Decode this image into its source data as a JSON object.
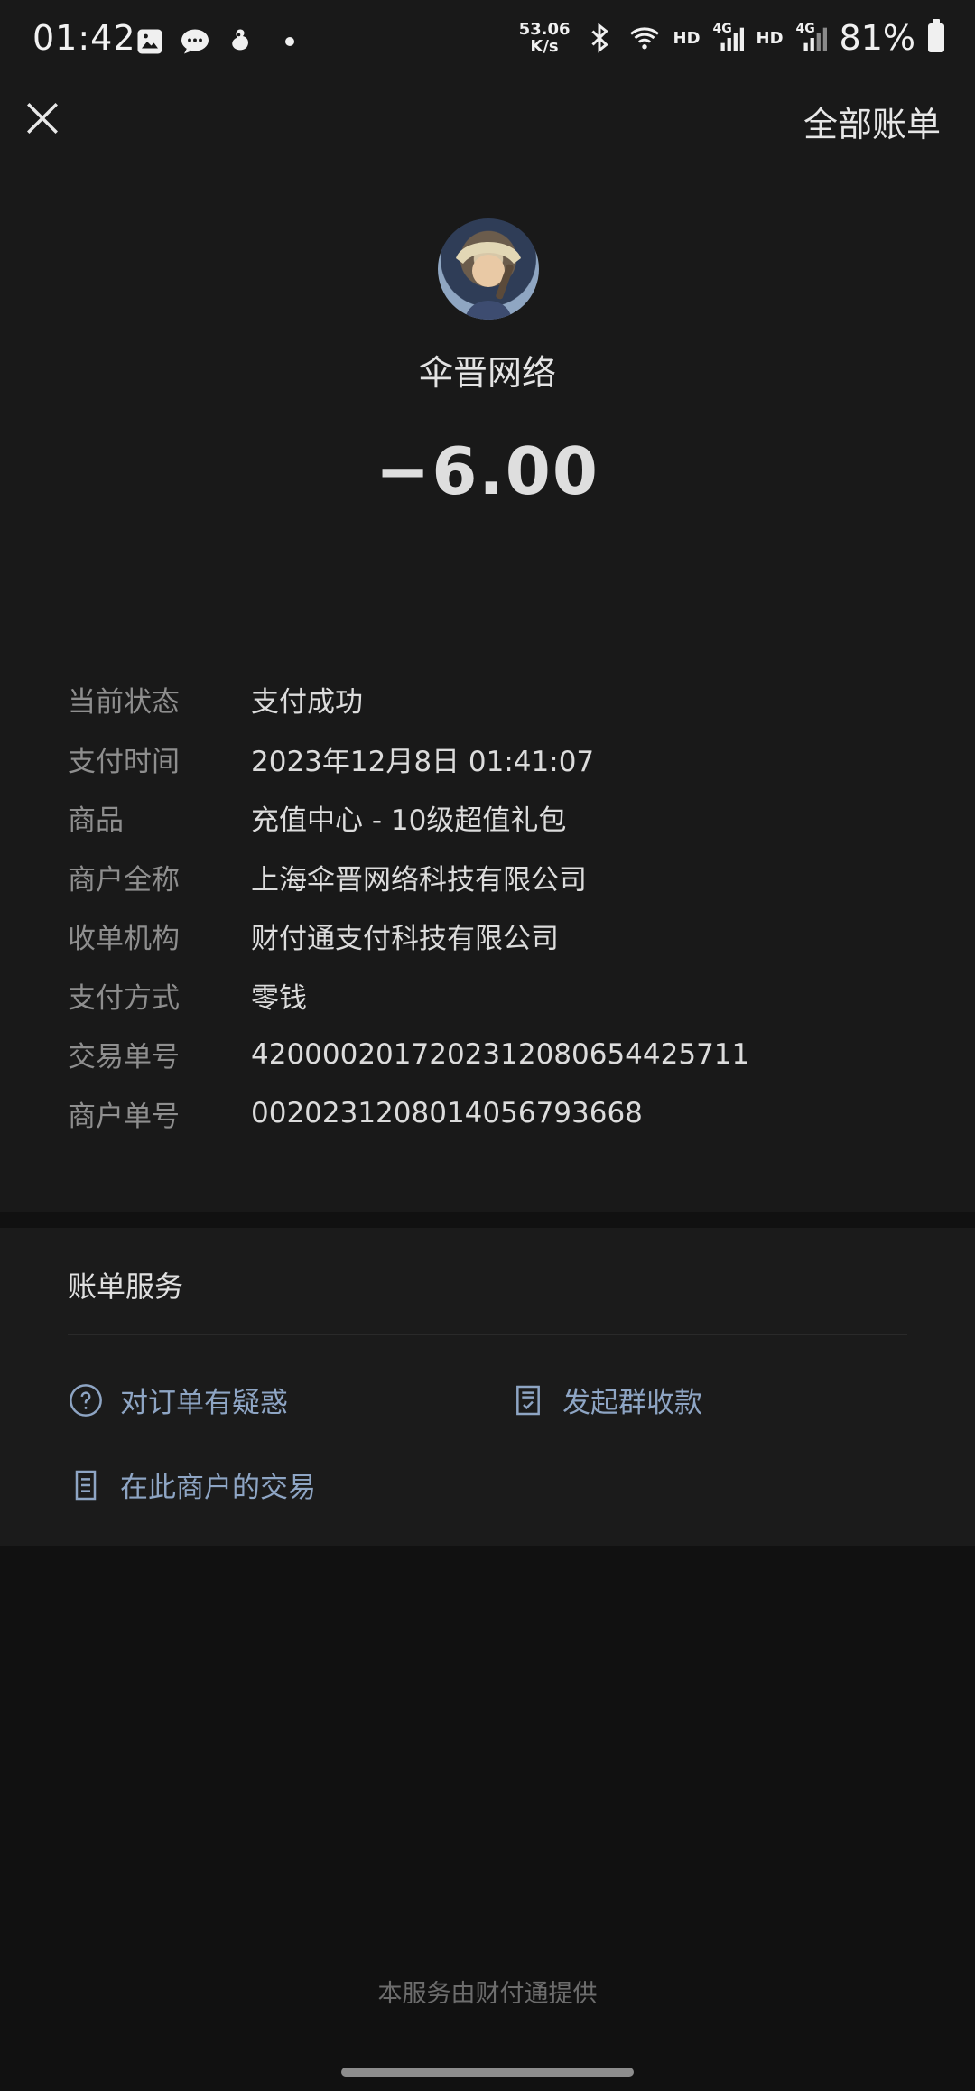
{
  "status_bar": {
    "time": "01:42",
    "speed_value": "53.06",
    "speed_unit": "K/s",
    "hd1": "HD",
    "net1": "4G",
    "hd2": "HD",
    "net2": "4G",
    "battery_pct": "81%",
    "icons": [
      "image-icon",
      "chat-icon",
      "app-icon",
      "bluetooth-icon",
      "wifi-icon",
      "signal-icon",
      "battery-icon"
    ]
  },
  "header": {
    "close_icon": "close-icon",
    "all_bills": "全部账单"
  },
  "payment": {
    "merchant_name": "伞晋网络",
    "amount": "−6.00"
  },
  "details": [
    {
      "label": "当前状态",
      "value": "支付成功"
    },
    {
      "label": "支付时间",
      "value": "2023年12月8日 01:41:07"
    },
    {
      "label": "商品",
      "value": "充值中心 - 10级超值礼包"
    },
    {
      "label": "商户全称",
      "value": "上海伞晋网络科技有限公司"
    },
    {
      "label": "收单机构",
      "value": "财付通支付科技有限公司"
    },
    {
      "label": "支付方式",
      "value": "零钱"
    },
    {
      "label": "交易单号",
      "value": "4200002017202312080654425711"
    },
    {
      "label": "商户单号",
      "value": "0020231208014056793668"
    }
  ],
  "service": {
    "title": "账单服务",
    "items": [
      {
        "label": "对订单有疑惑",
        "icon": "question-icon"
      },
      {
        "label": "发起群收款",
        "icon": "checklist-icon"
      },
      {
        "label": "在此商户的交易",
        "icon": "document-icon"
      }
    ]
  },
  "footer": {
    "note": "本服务由财付通提供"
  },
  "colors": {
    "background": "#111111",
    "card": "#191919",
    "link": "#8ea5c4",
    "label": "#8e8e8e"
  }
}
